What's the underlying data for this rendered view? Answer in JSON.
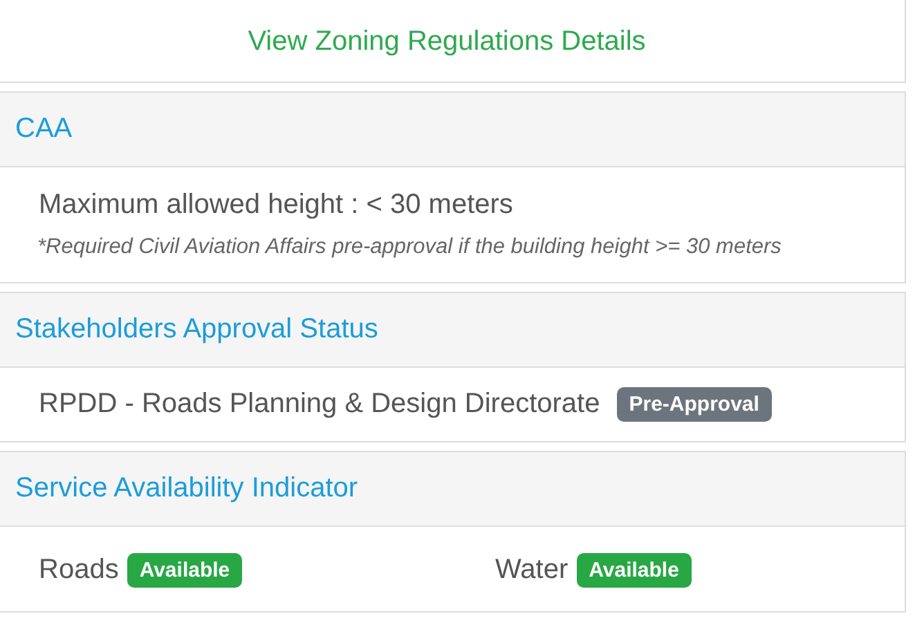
{
  "zoning": {
    "link": "View Zoning Regulations Details"
  },
  "sections": [
    {
      "kind": "limits",
      "title": "CAA",
      "text": "Maximum allowed height : < 30 meters",
      "note": "*Required Civil Aviation Affairs pre-approval if the building height >= 30 meters"
    },
    {
      "kind": "approvals",
      "title": "Stakeholders Approval Status",
      "items": [
        {
          "name": "RPDD - Roads Planning & Design Directorate",
          "status": "Pre-Approval",
          "color": "#6c757d"
        }
      ]
    },
    {
      "kind": "services",
      "title": "Service Availability Indicator",
      "items": [
        {
          "name": "Roads",
          "status": "Available",
          "color": "#28a745"
        },
        {
          "name": "Water",
          "status": "Available",
          "color": "#28a745"
        }
      ]
    }
  ]
}
